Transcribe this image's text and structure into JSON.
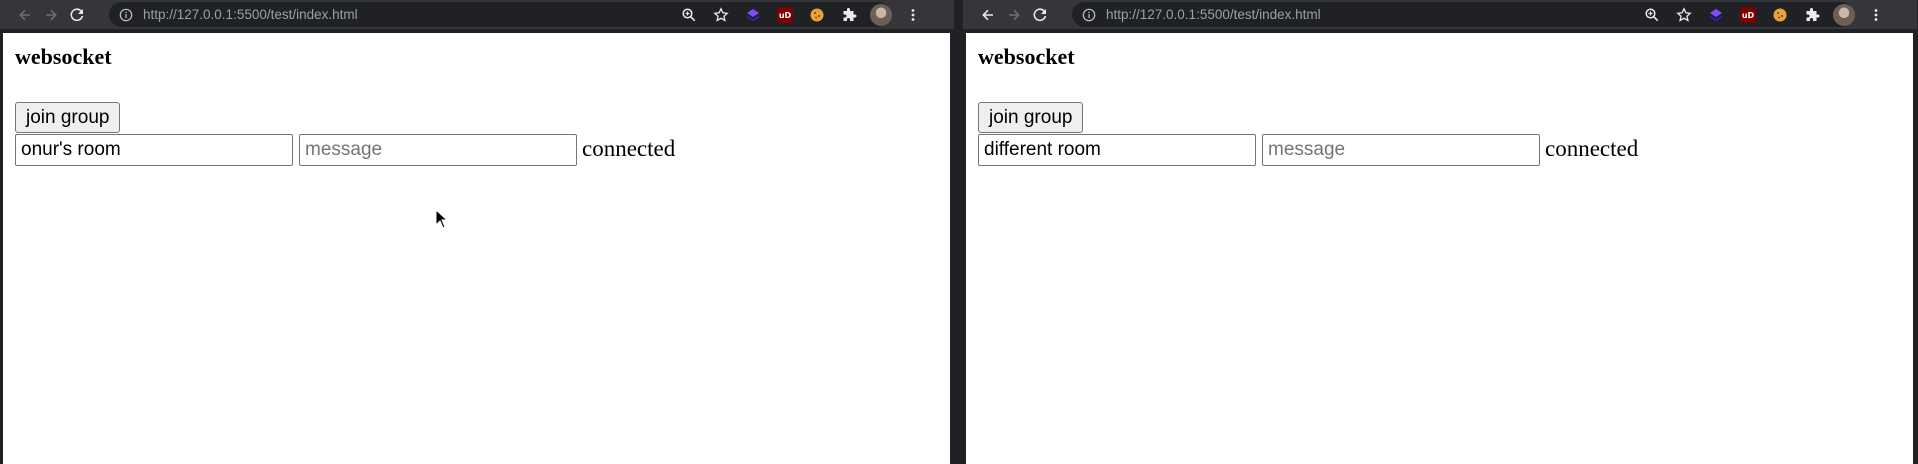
{
  "windows": [
    {
      "url_full": "http://127.0.0.1:5500/test/index.html",
      "page": {
        "heading": "websocket",
        "join_button": "join group",
        "room_input_value": "onur's room",
        "message_placeholder": "message",
        "status": "connected"
      }
    },
    {
      "url_full": "http://127.0.0.1:5500/test/index.html",
      "page": {
        "heading": "websocket",
        "join_button": "join group",
        "room_input_value": "different room",
        "message_placeholder": "message",
        "status": "connected"
      }
    }
  ],
  "toolbar_icons": [
    "back-icon",
    "forward-icon",
    "reload-icon",
    "site-info-icon",
    "zoom-icon",
    "star-icon",
    "extension-purple-icon",
    "ublock-icon",
    "cookie-icon",
    "puzzle-icon",
    "profile-avatar",
    "menu-icon"
  ],
  "extension_labels": {
    "ublock": "uD"
  },
  "colors": {
    "toolbar_bg": "#35363a",
    "frame_bg": "#202124",
    "omnibox_bg": "#202124",
    "url_muted": "#9aa0a6",
    "url_text": "#e8eaed",
    "page_bg": "#ffffff"
  }
}
